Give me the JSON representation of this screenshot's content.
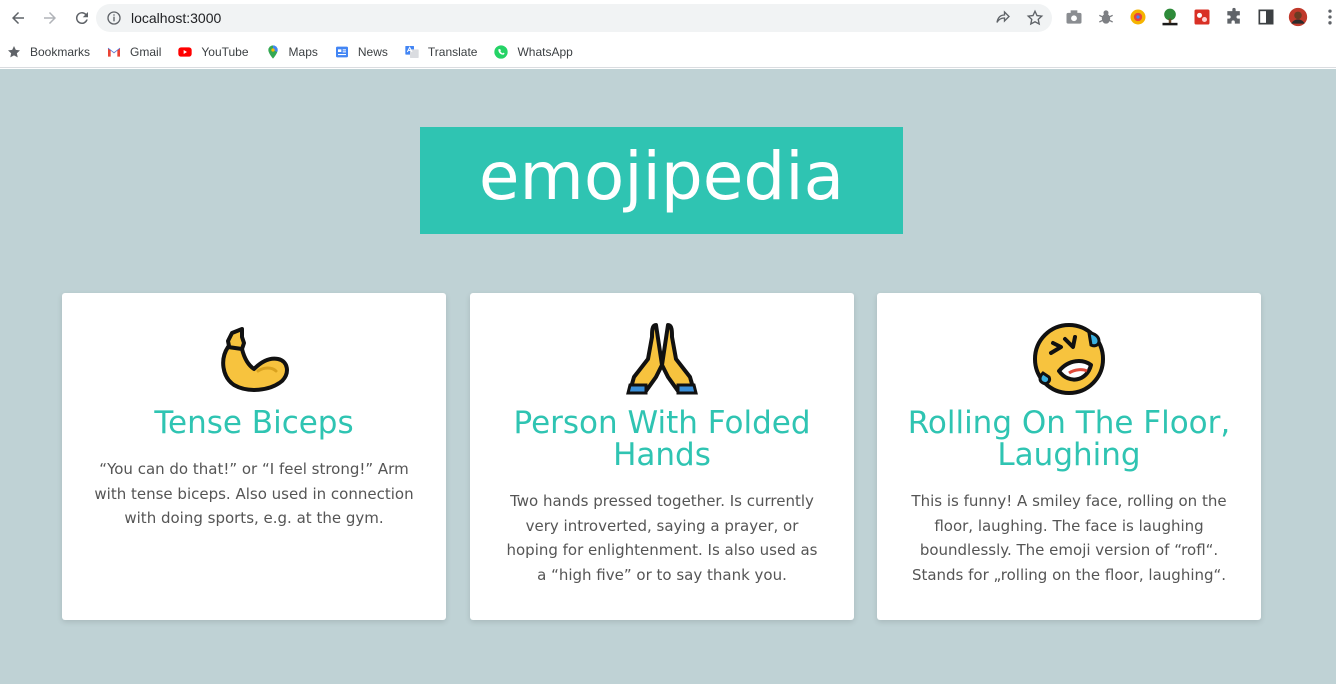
{
  "browser": {
    "url": "localhost:3000",
    "bookmarks": [
      {
        "label": "Bookmarks",
        "icon": "star-icon"
      },
      {
        "label": "Gmail",
        "icon": "gmail-icon"
      },
      {
        "label": "YouTube",
        "icon": "youtube-icon"
      },
      {
        "label": "Maps",
        "icon": "maps-icon"
      },
      {
        "label": "News",
        "icon": "news-icon"
      },
      {
        "label": "Translate",
        "icon": "translate-icon"
      },
      {
        "label": "WhatsApp",
        "icon": "whatsapp-icon"
      }
    ]
  },
  "page": {
    "title": "emojipedia",
    "background_color": "#bfd2d5",
    "accent_color": "#2fc4b2",
    "cards": [
      {
        "name": "Tense Biceps",
        "emoji": "flexed-biceps-icon",
        "description": "“You can do that!” or “I feel strong!” Arm with tense biceps. Also used in connection with doing sports, e.g. at the gym."
      },
      {
        "name": "Person With Folded Hands",
        "emoji": "folded-hands-icon",
        "description": "Two hands pressed together. Is currently very introverted, saying a prayer, or hoping for enlightenment. Is also used as a “high five” or to say thank you."
      },
      {
        "name": "Rolling On The Floor, Laughing",
        "emoji": "rofl-face-icon",
        "description": "This is funny! A smiley face, rolling on the floor, laughing. The face is laughing boundlessly. The emoji version of “rofl“. Stands for „rolling on the floor, laughing“."
      }
    ]
  }
}
